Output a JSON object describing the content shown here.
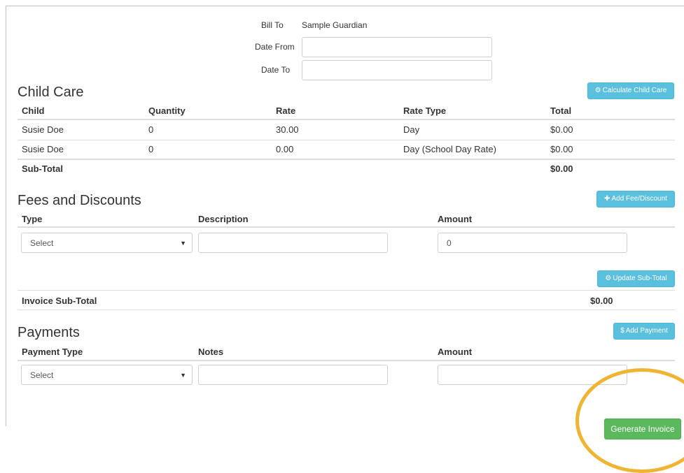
{
  "billing": {
    "bill_to_label": "Bill To",
    "bill_to_value": "Sample Guardian",
    "date_from_label": "Date From",
    "date_from_value": "",
    "date_to_label": "Date To",
    "date_to_value": ""
  },
  "child_care": {
    "title": "Child Care",
    "calculate_button": "Calculate Child Care",
    "columns": [
      "Child",
      "Quantity",
      "Rate",
      "Rate Type",
      "Total"
    ],
    "rows": [
      [
        "Susie Doe",
        "0",
        "30.00",
        "Day",
        "$0.00"
      ],
      [
        "Susie Doe",
        "0",
        "0.00",
        "Day (School Day Rate)",
        "$0.00"
      ]
    ],
    "subtotal_label": "Sub-Total",
    "subtotal_value": "$0.00"
  },
  "fees": {
    "title": "Fees and Discounts",
    "add_button": "Add Fee/Discount",
    "columns": [
      "Type",
      "Description",
      "Amount"
    ],
    "type_selected": "Select",
    "description_value": "",
    "amount_value": "0",
    "update_button": "Update Sub-Total",
    "invoice_subtotal_label": "Invoice Sub-Total",
    "invoice_subtotal_value": "$0.00"
  },
  "payments": {
    "title": "Payments",
    "add_button": "Add Payment",
    "columns": [
      "Payment Type",
      "Notes",
      "Amount"
    ],
    "type_selected": "Select",
    "notes_value": "",
    "amount_value": ""
  },
  "generate_button": "Generate Invoice",
  "icons": {
    "cogs": "cogs-icon",
    "plus": "plus-icon",
    "dollar": "dollar-icon",
    "caret": "caret-down-icon"
  },
  "colors": {
    "info_button": "#5bc0de",
    "success_button": "#5cb85c",
    "highlight_ring": "#f0b433"
  }
}
